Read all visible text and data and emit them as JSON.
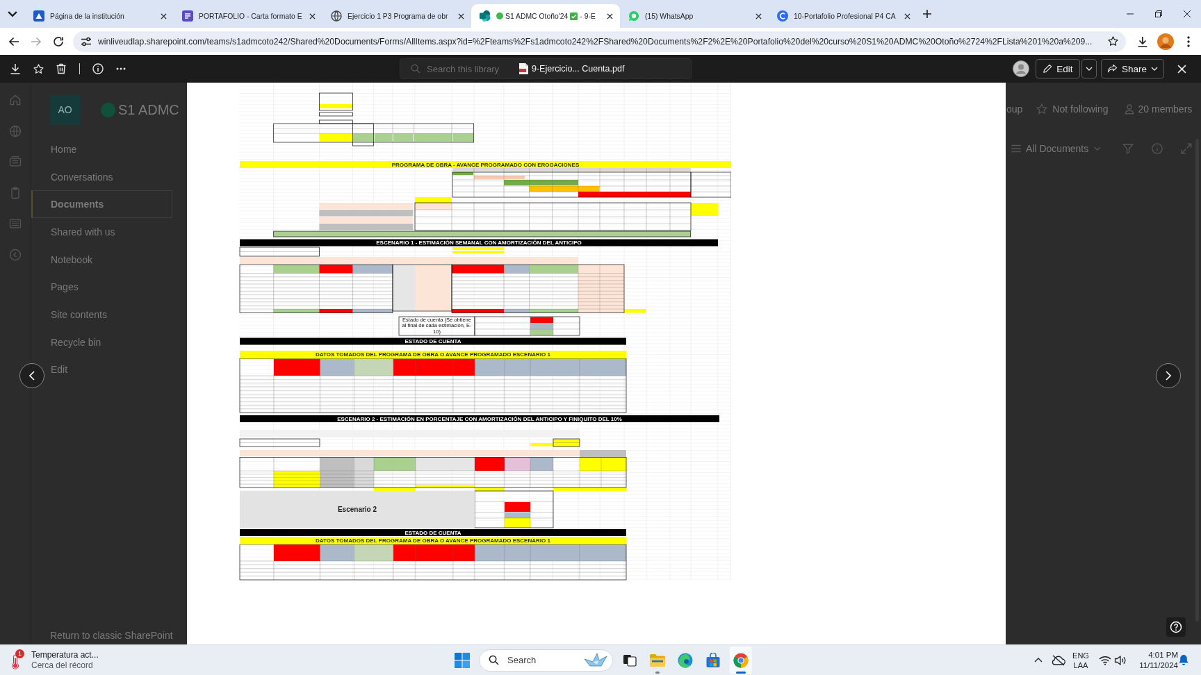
{
  "browser": {
    "tabs": [
      {
        "title": "Página de la institución",
        "selected": false
      },
      {
        "title": "PORTAFOLIO - Carta formato E",
        "selected": false
      },
      {
        "title": "Ejercicio 1 P3 Programa de obr",
        "selected": false
      },
      {
        "title": "S1 ADMC Otoño'24",
        "title_after_icon": "- 9-E",
        "selected": true
      },
      {
        "title": "(15) WhatsApp",
        "selected": false
      },
      {
        "title": "10-Portafolio Profesional P4 CA",
        "selected": false
      }
    ],
    "forward_disabled": true,
    "address": "winliveudlap.sharepoint.com/teams/s1admcoto242/Shared%20Documents/Forms/AllItems.aspx?id=%2Fteams%2Fs1admcoto242%2FShared%20Documents%2F2%2E%20Portafolio%20del%20curso%20S1%20ADMC%20Otoño%2724%2FLista%201%20a%209..."
  },
  "viewer_toolbar": {
    "search": {
      "placeholder": "Search this library"
    },
    "file_name": "9-Ejercicio... Cuenta.pdf",
    "edit_label": "Edit",
    "share_label": "Share"
  },
  "site_background": {
    "logo": "AO",
    "site_name": "S1 ADMC",
    "nav": [
      {
        "label": "Home",
        "selected": false
      },
      {
        "label": "Conversations",
        "selected": false
      },
      {
        "label": "Documents",
        "selected": true
      },
      {
        "label": "Shared with us",
        "selected": false
      },
      {
        "label": "Notebook",
        "selected": false
      },
      {
        "label": "Pages",
        "selected": false
      },
      {
        "label": "Site contents",
        "selected": false
      },
      {
        "label": "Recycle bin",
        "selected": false
      },
      {
        "label": "Edit",
        "selected": false
      }
    ],
    "footer_link": "Return to classic SharePoint",
    "group_label": "oup",
    "follow_label": "Not following",
    "members_label": "20 members",
    "view_name": "All Documents"
  },
  "document": {
    "sections": [
      {
        "kind": "heading_yellow",
        "text": "PROGRAMA DE OBRA - AVANCE PROGRAMADO CON EROGACIONES"
      },
      {
        "kind": "heading_black",
        "text": "ESCENARIO 1 - ESTIMACIÓN SEMANAL CON AMORTIZACIÓN DEL ANTICIPO"
      },
      {
        "kind": "note",
        "text": "Estado de cuenta (Se obtiene al final de cada estimación, E-10)"
      },
      {
        "kind": "heading_black",
        "text": "ESTADO DE CUENTA"
      },
      {
        "kind": "heading_yellow",
        "text": "DATOS TOMADOS DEL PROGRAMA DE OBRA O AVANCE PROGRAMADO ESCENARIO 1"
      },
      {
        "kind": "heading_black",
        "text": "ESCENARIO 2 - ESTIMACIÓN EN PORCENTAJE CON AMORTIZACIÓN DEL ANTICIPO Y FINIQUITO DEL 10%"
      },
      {
        "kind": "title_cell",
        "text": "Escenario 2"
      },
      {
        "kind": "heading_black",
        "text": "ESTADO DE CUENTA"
      },
      {
        "kind": "heading_yellow",
        "text": "DATOS TOMADOS DEL PROGRAMA DE OBRA O AVANCE PROGRAMADO ESCENARIO 1"
      }
    ]
  },
  "taskbar": {
    "weather": {
      "badge": "1",
      "title": "Temperatura act...",
      "subtitle": "Cerca del récord"
    },
    "search": {
      "placeholder": "Search"
    },
    "apps": [
      {
        "running": false,
        "active": false
      },
      {
        "running": true,
        "active": false
      },
      {
        "running": false,
        "active": false
      },
      {
        "running": false,
        "active": false
      },
      {
        "running": true,
        "active": true
      }
    ],
    "language": {
      "line_1": "ENG",
      "line_2": "LAA"
    },
    "clock": {
      "time": "4:01 PM",
      "date": "11/11/2024"
    }
  }
}
